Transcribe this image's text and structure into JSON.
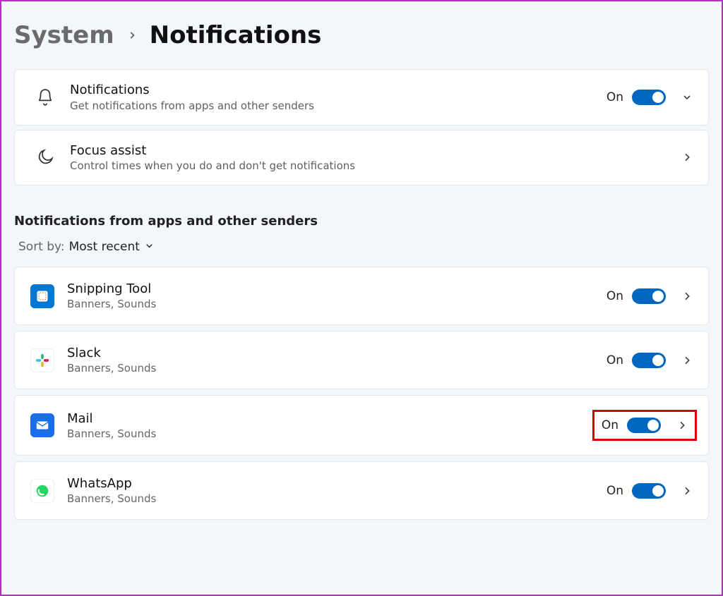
{
  "breadcrumb": {
    "parent": "System",
    "current": "Notifications"
  },
  "main_cards": {
    "notifications": {
      "title": "Notifications",
      "subtitle": "Get notifications from apps and other senders",
      "status": "On"
    },
    "focus": {
      "title": "Focus assist",
      "subtitle": "Control times when you do and don't get notifications"
    }
  },
  "section_title": "Notifications from apps and other senders",
  "sort": {
    "label": "Sort by:",
    "value": "Most recent"
  },
  "apps": [
    {
      "name": "Snipping Tool",
      "sub": "Banners, Sounds",
      "status": "On"
    },
    {
      "name": "Slack",
      "sub": "Banners, Sounds",
      "status": "On"
    },
    {
      "name": "Mail",
      "sub": "Banners, Sounds",
      "status": "On"
    },
    {
      "name": "WhatsApp",
      "sub": "Banners, Sounds",
      "status": "On"
    }
  ]
}
